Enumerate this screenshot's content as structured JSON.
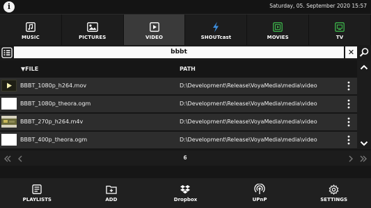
{
  "topbar": {
    "info_icon": "info-icon",
    "datetime": "Saturday, 05. September 2020 15:57"
  },
  "tabs": [
    {
      "label": "MUSIC",
      "icon": "music-icon",
      "active": false
    },
    {
      "label": "PICTURES",
      "icon": "pictures-icon",
      "active": false
    },
    {
      "label": "VIDEO",
      "icon": "video-icon",
      "active": true
    },
    {
      "label": "SHOUTcast",
      "icon": "shoutcast-icon",
      "active": false
    },
    {
      "label": "MOVIES",
      "icon": "movies-icon",
      "active": false
    },
    {
      "label": "TV",
      "icon": "tv-icon",
      "active": false
    }
  ],
  "search": {
    "value": "bbbt",
    "clear_label": "✕"
  },
  "list": {
    "file_header": "▼FILE",
    "path_header": "PATH",
    "rows": [
      {
        "file": "BBBT_1080p_h264.mov",
        "path": "D:\\Development\\Release\\VoyaMedia\\media\\video",
        "thumb": "play-thumbnail"
      },
      {
        "file": "BBBT_1080p_theora.ogm",
        "path": "D:\\Development\\Release\\VoyaMedia\\media\\video",
        "thumb": "blank-thumbnail"
      },
      {
        "file": "BBBT_270p_h264.m4v",
        "path": "D:\\Development\\Release\\VoyaMedia\\media\\video",
        "thumb": "video-thumbnail"
      },
      {
        "file": "BBBT_400p_theora.ogm",
        "path": "D:\\Development\\Release\\VoyaMedia\\media\\video",
        "thumb": "blank-thumbnail"
      }
    ]
  },
  "pager": {
    "page": "6"
  },
  "bottom": [
    {
      "label": "PLAYLISTS",
      "icon": "playlists-icon"
    },
    {
      "label": "ADD",
      "icon": "add-folder-icon"
    },
    {
      "label": "Dropbox",
      "icon": "dropbox-icon"
    },
    {
      "label": "UPnP",
      "icon": "upnp-icon"
    },
    {
      "label": "SETTINGS",
      "icon": "settings-icon"
    }
  ],
  "colors": {
    "shoutcast_accent": "#3d8fe0",
    "movies_accent": "#3db34a",
    "tv_accent": "#3db34a"
  }
}
